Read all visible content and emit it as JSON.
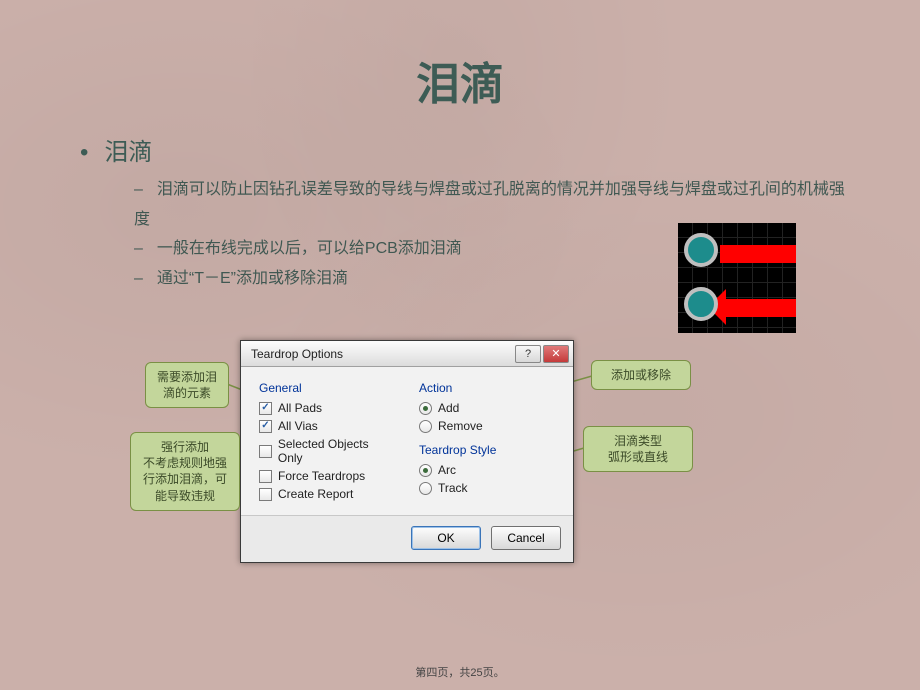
{
  "slide": {
    "title": "泪滴",
    "bullet_main": "泪滴",
    "bullets": [
      "泪滴可以防止因钻孔误差导致的导线与焊盘或过孔脱离的情况并加强导线与焊盘或过孔间的机械强度",
      "一般在布线完成以后，可以给PCB添加泪滴",
      "通过“T－E”添加或移除泪滴"
    ],
    "footer": "第四页，共25页。"
  },
  "dialog": {
    "title": "Teardrop Options",
    "groups": {
      "general": {
        "title": "General",
        "options": [
          {
            "label": "All Pads",
            "checked": true
          },
          {
            "label": "All Vias",
            "checked": true
          },
          {
            "label": "Selected Objects Only",
            "checked": false
          },
          {
            "label": "Force Teardrops",
            "checked": false
          },
          {
            "label": "Create Report",
            "checked": false
          }
        ]
      },
      "action": {
        "title": "Action",
        "options": [
          {
            "label": "Add",
            "selected": true
          },
          {
            "label": "Remove",
            "selected": false
          }
        ]
      },
      "style": {
        "title": "Teardrop Style",
        "options": [
          {
            "label": "Arc",
            "selected": true
          },
          {
            "label": "Track",
            "selected": false
          }
        ]
      }
    },
    "buttons": {
      "ok": "OK",
      "cancel": "Cancel"
    },
    "window_buttons": {
      "help": "?",
      "close": "✕"
    }
  },
  "callouts": {
    "c1": "需要添加泪滴的元素",
    "c2": "强行添加\n不考虑规则地强行添加泪滴，可能导致违规",
    "c3": "添加或移除",
    "c4": "泪滴类型\n弧形或直线"
  }
}
